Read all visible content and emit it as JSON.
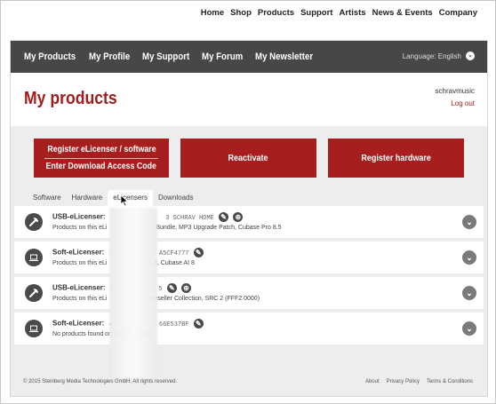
{
  "top_nav": [
    "Home",
    "Shop",
    "Products",
    "Support",
    "Artists",
    "News & Events",
    "Company"
  ],
  "sub_nav": {
    "tabs": [
      "My Products",
      "My Profile",
      "My Support",
      "My Forum",
      "My Newsletter"
    ],
    "language": "Language: English"
  },
  "header": {
    "title": "My products",
    "username": "schravmusic",
    "logout": "Log out"
  },
  "buttons": {
    "register_elicenser_line1": "Register eLicenser / software",
    "register_elicenser_line2": "Enter Download Access Code",
    "reactivate": "Reactivate",
    "register_hardware": "Register hardware"
  },
  "tabs": [
    "Software",
    "Hardware",
    "eLicensers",
    "Downloads"
  ],
  "active_tab": "eLicensers",
  "licensers": [
    {
      "type": "USB-eLicenser:",
      "serial_left": "1",
      "serial_right": "3  SCHRAV HOME",
      "products": "Products on this eLi",
      "products_tail": "tico Bundle, MP3 Upgrade Patch, Cubase Pro 8.5",
      "icon": "usb-key-icon"
    },
    {
      "type": "Soft-eLicenser:",
      "serial_left": "7",
      "serial_right": "A5CF4777",
      "products": "Products on this eLi",
      "products_tail": "LE 8, Cubase AI 8",
      "icon": "laptop-icon"
    },
    {
      "type": "USB-eLicenser:",
      "serial_left": "8",
      "serial_right": "5",
      "products": "Products on this eLi",
      "products_tail": "g Reseller Collection, SRC 2 (FFF2 0000)",
      "icon": "usb-key-icon"
    },
    {
      "type": "Soft-eLicenser:",
      "serial_left": "4",
      "serial_right": "66E537BF",
      "products": "No products found on this eLicenser.",
      "products_tail": "",
      "icon": "laptop-icon"
    }
  ],
  "footer": {
    "copyright": "© 2015 Steinberg Media Technologies GmbH. All rights reserved.",
    "links": [
      "About",
      "Privacy Policy",
      "Terms & Conditions"
    ]
  },
  "colors": {
    "accent": "#a81e1e",
    "subnav_bg": "#474747",
    "page_bg": "#ededed"
  }
}
